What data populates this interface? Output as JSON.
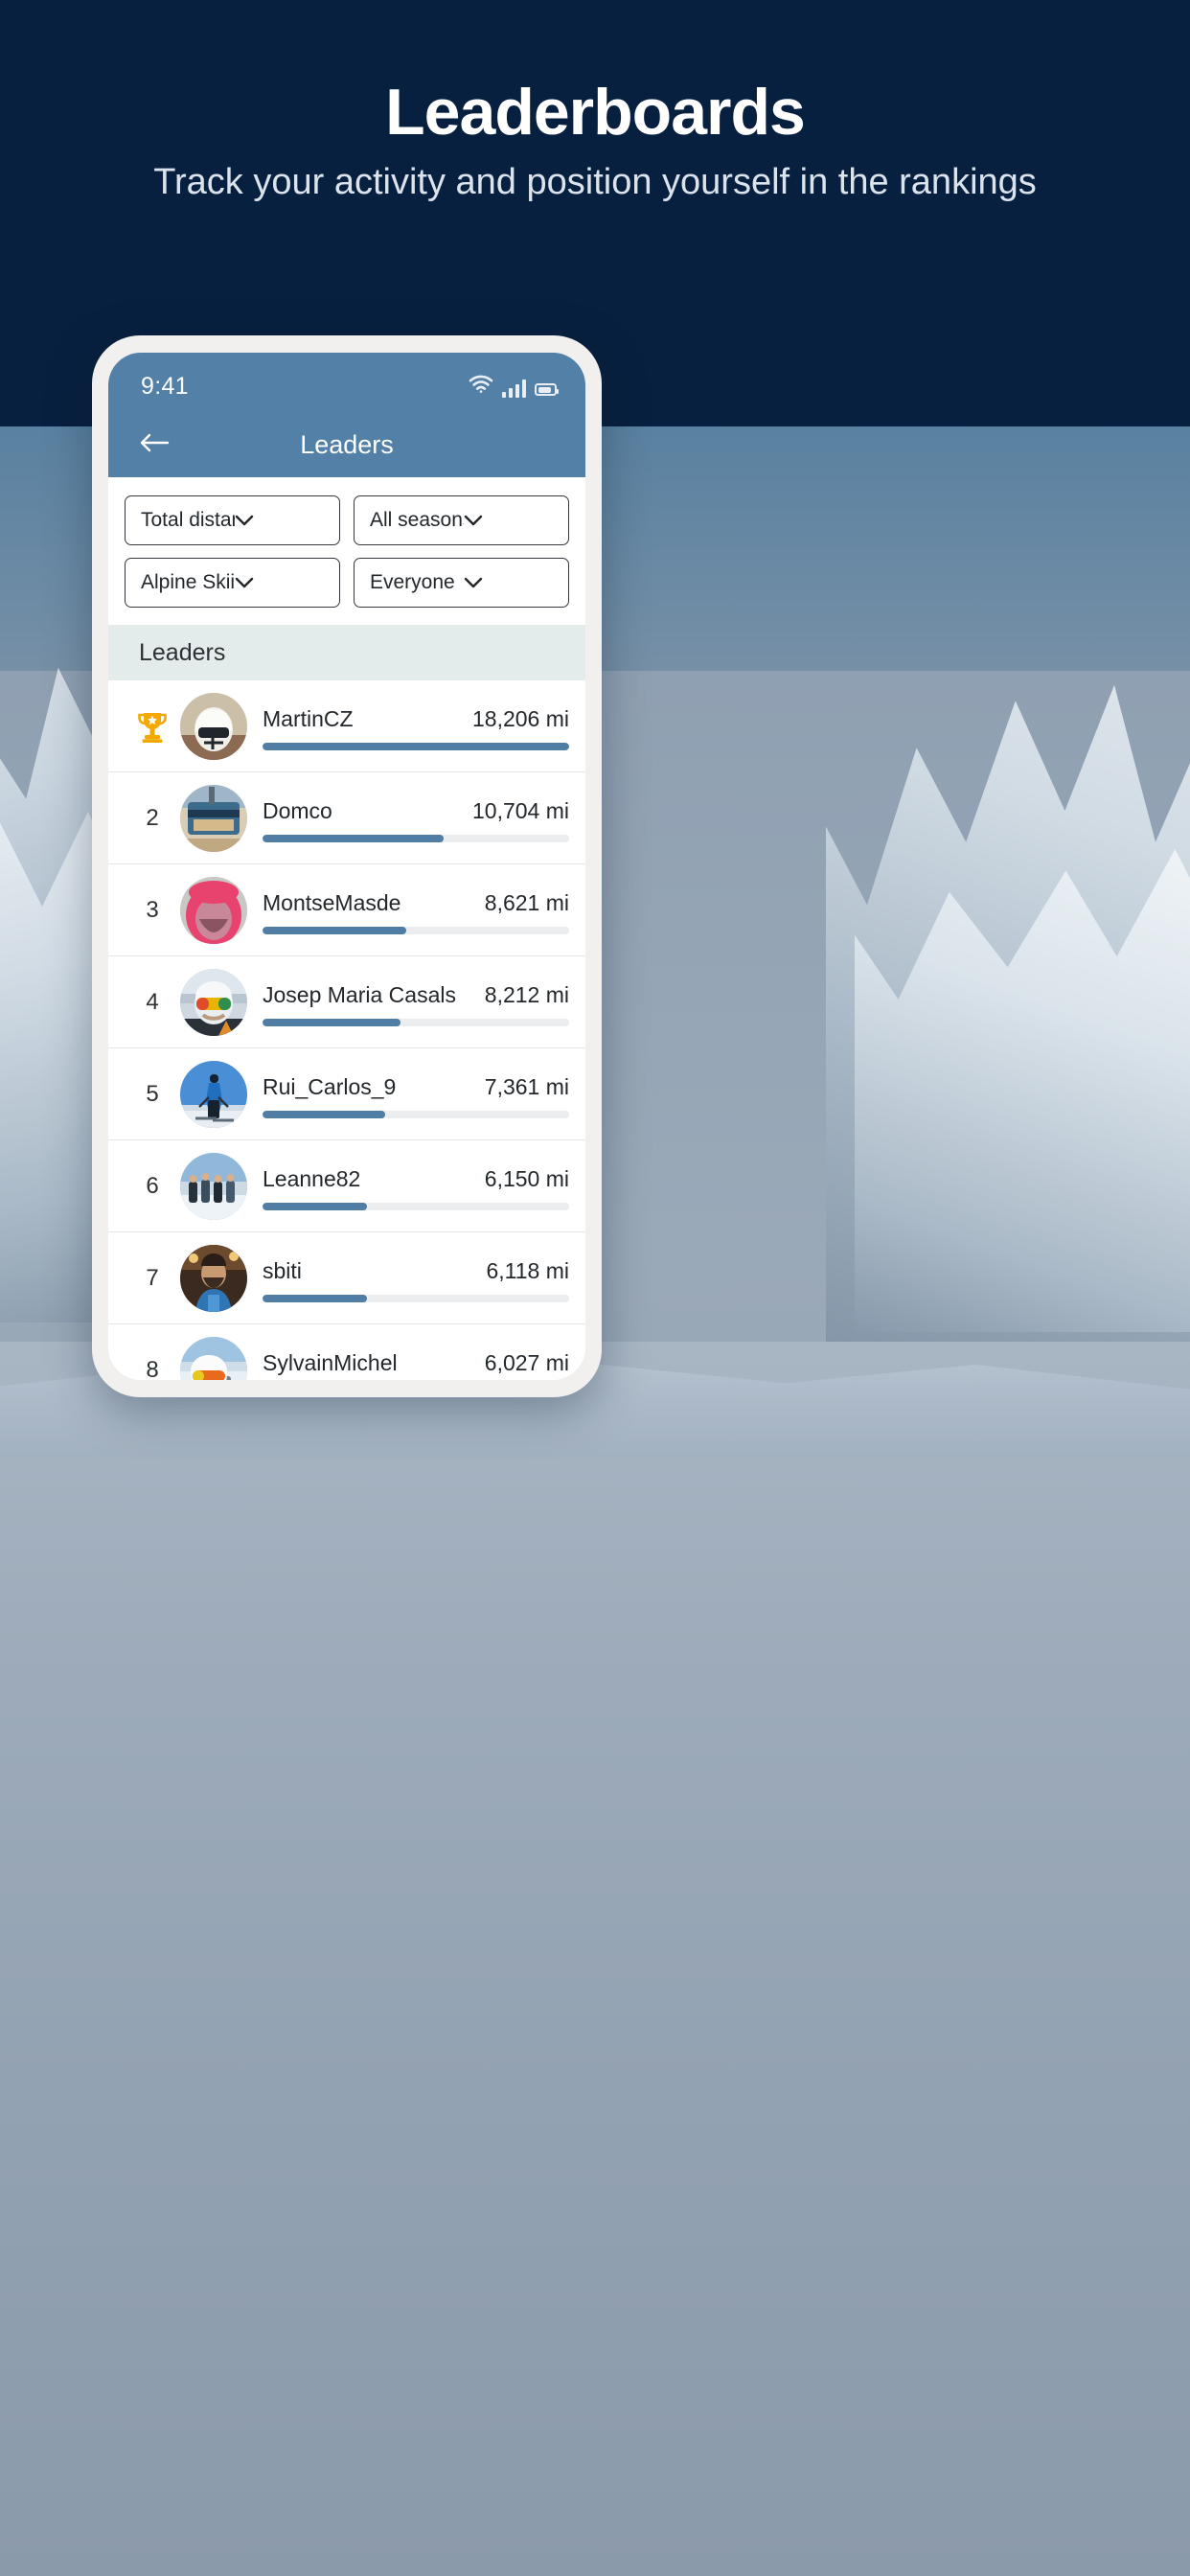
{
  "hero": {
    "title": "Leaderboards",
    "subtitle": "Track your activity and position yourself in the rankings",
    "bg_color": "#08203f",
    "text_color": "#ffffff"
  },
  "phone": {
    "status_bar": {
      "time": "9:41",
      "icons": [
        "wifi-icon",
        "cellular-signal-icon",
        "battery-icon"
      ]
    },
    "nav": {
      "back_icon": "arrow-left-icon",
      "title": "Leaders",
      "bar_color": "#5280a6"
    },
    "filters": [
      {
        "name": "metric",
        "value": "Total distance",
        "icon": "chevron-down-icon"
      },
      {
        "name": "season",
        "value": "All seasons",
        "icon": "chevron-down-icon"
      },
      {
        "name": "sport",
        "value": "Alpine Skiing",
        "icon": "chevron-down-icon"
      },
      {
        "name": "audience",
        "value": "Everyone",
        "icon": "chevron-down-icon"
      }
    ],
    "section_header": "Leaders",
    "accent_color": "#4f7da4",
    "leaders": [
      {
        "rank": "",
        "rank_icon": "trophy-icon",
        "name": "MartinCZ",
        "distance": "18,206 mi",
        "bar_pct": 100,
        "avatar": "helmet-avatar"
      },
      {
        "rank": "2",
        "rank_icon": "",
        "name": "Domco",
        "distance": "10,704 mi",
        "bar_pct": 59,
        "avatar": "lift-avatar"
      },
      {
        "rank": "3",
        "rank_icon": "",
        "name": "MontseMasde",
        "distance": "8,621 mi",
        "bar_pct": 47,
        "avatar": "pinkhood-avatar"
      },
      {
        "rank": "4",
        "rank_icon": "",
        "name": "Josep Maria Casals",
        "distance": "8,212 mi",
        "bar_pct": 45,
        "avatar": "goggles-avatar"
      },
      {
        "rank": "5",
        "rank_icon": "",
        "name": "Rui_Carlos_9",
        "distance": "7,361 mi",
        "bar_pct": 40,
        "avatar": "skier-avatar"
      },
      {
        "rank": "6",
        "rank_icon": "",
        "name": "Leanne82",
        "distance": "6,150 mi",
        "bar_pct": 34,
        "avatar": "group-avatar"
      },
      {
        "rank": "7",
        "rank_icon": "",
        "name": "sbiti",
        "distance": "6,118 mi",
        "bar_pct": 34,
        "avatar": "apres-avatar"
      },
      {
        "rank": "8",
        "rank_icon": "",
        "name": "SylvainMichel",
        "distance": "6,027 mi",
        "bar_pct": 33,
        "avatar": "selfie-avatar"
      }
    ]
  },
  "chart_data": {
    "type": "bar",
    "title": "Leaders",
    "xlabel": "",
    "ylabel": "Total distance (mi)",
    "categories": [
      "MartinCZ",
      "Domco",
      "MontseMasde",
      "Josep Maria Casals",
      "Rui_Carlos_9",
      "Leanne82",
      "sbiti",
      "SylvainMichel"
    ],
    "values": [
      18206,
      10704,
      8621,
      8212,
      7361,
      6150,
      6118,
      6027
    ],
    "ylim": [
      0,
      18206
    ],
    "grid": false,
    "legend": "none"
  }
}
